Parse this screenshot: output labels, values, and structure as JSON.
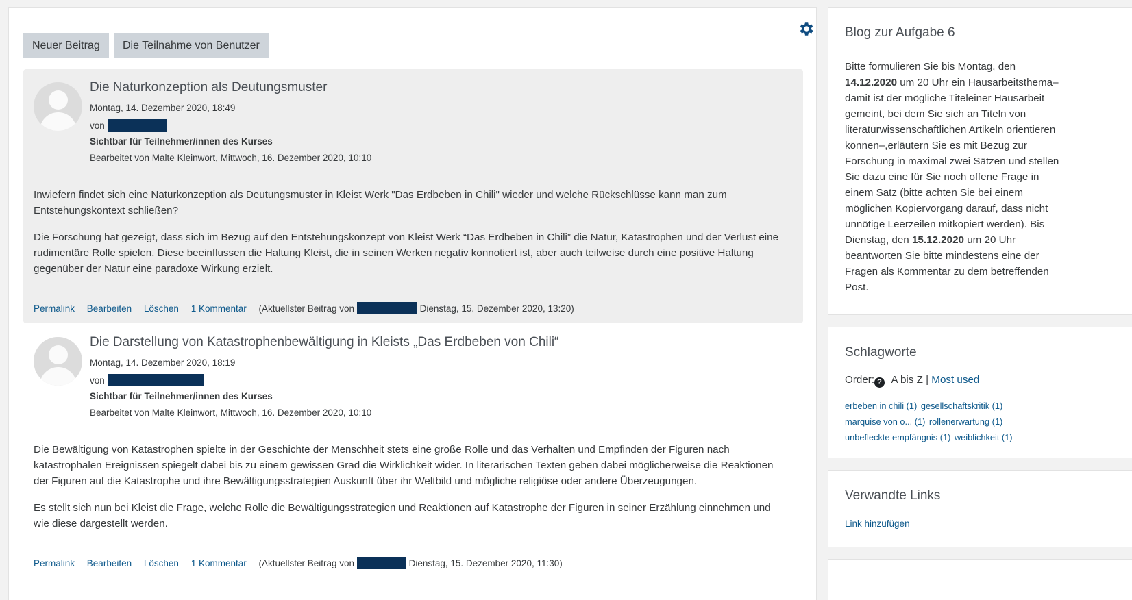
{
  "toolbar": {
    "new_entry_label": "Neuer Beitrag",
    "participation_label": "Die Teilnahme von Benutzer",
    "settings_icon": "gear-icon"
  },
  "posts": [
    {
      "title": "Die Naturkonzeption als Deutungsmuster",
      "date": "Montag, 14. Dezember 2020, 18:49",
      "by_label": "von",
      "visibility": "Sichtbar für Teilnehmer/innen des Kurses",
      "edited": "Bearbeitet von Malte Kleinwort, Mittwoch, 16. Dezember 2020, 10:10",
      "paragraphs": [
        "Inwiefern findet sich eine Naturkonzeption als Deutungsmuster in Kleist Werk \"Das Erdbeben in Chili\" wieder und welche Rückschlüsse kann man zum Entstehungskontext schließen?",
        "Die Forschung hat gezeigt, dass sich im Bezug auf den Entstehungskonzept von Kleist Werk “Das Erdbeben in Chili” die Natur, Katastrophen und der Verlust eine rudimentäre Rolle spielen. Diese beeinflussen die Haltung Kleist, die in seinen Werken negativ konnotiert ist, aber auch teilweise durch eine positive Haltung gegenüber der Natur eine paradoxe Wirkung erzielt."
      ],
      "footer": {
        "permalink": "Permalink",
        "edit": "Bearbeiten",
        "delete": "Löschen",
        "comments": "1 Kommentar",
        "latest_prefix": "(Aktuellster Beitrag von",
        "latest_suffix": "Dienstag, 15. Dezember 2020, 13:20)"
      }
    },
    {
      "title": "Die Darstellung von Katastrophenbewältigung in Kleists „Das Erdbeben von Chili“",
      "date": "Montag, 14. Dezember 2020, 18:19",
      "by_label": "von",
      "visibility": "Sichtbar für Teilnehmer/innen des Kurses",
      "edited": "Bearbeitet von Malte Kleinwort, Mittwoch, 16. Dezember 2020, 10:10",
      "paragraphs": [
        "Die Bewältigung von Katastrophen spielte in der Geschichte der Menschheit stets eine große Rolle und das Verhalten und Empfinden der Figuren nach katastrophalen Ereignissen spiegelt dabei bis zu einem gewissen Grad die Wirklichkeit wider. In literarischen Texten geben dabei möglicherweise die Reaktionen der Figuren auf die Katastrophe und ihre Bewältigungsstrategien Auskunft über ihr Weltbild und mögliche religiöse oder andere Überzeugungen.",
        "Es stellt sich nun bei Kleist die Frage, welche Rolle die Bewältigungsstrategien und Reaktionen auf Katastrophe der Figuren in seiner Erzählung einnehmen und wie diese dargestellt werden."
      ],
      "footer": {
        "permalink": "Permalink",
        "edit": "Bearbeiten",
        "delete": "Löschen",
        "comments": "1 Kommentar",
        "latest_prefix": "(Aktuellster Beitrag von",
        "latest_suffix": "Dienstag, 15. Dezember 2020, 11:30)"
      }
    }
  ],
  "sidebar": {
    "blog": {
      "title": "Blog zur Aufgabe 6",
      "desc_1": "Bitte formulieren Sie bis Montag, den",
      "desc_date1": "14.12.2020",
      "desc_2": " um 20 Uhr ein Hausarbeitsthema–damit ist der mögliche Titeleiner Hausarbeit gemeint, bei dem Sie sich an Titeln von literaturwissenschaftlichen Artikeln orientieren können–,erläutern Sie es mit Bezug zur Forschung in maximal zwei Sätzen und stellen Sie dazu eine für Sie noch offene Frage in einem Satz (bitte achten Sie bei einem möglichen Kopiervorgang darauf, dass nicht unnötige Leerzeilen mitkopiert werden). Bis Dienstag, den ",
      "desc_date2": "15.12.2020",
      "desc_3": " um 20 Uhr beantworten Sie bitte mindestens eine der Fragen als Kommentar zu dem betreffenden Post."
    },
    "tags": {
      "title": "Schlagworte",
      "order_label": "Order:",
      "order_az": "A bis Z",
      "order_sep": "|",
      "order_most": "Most used",
      "items": [
        "erbeben in chili (1)",
        "gesellschaftskritik (1)",
        "marquise von o... (1)",
        "rollenerwartung (1)",
        "unbefleckte empfängnis (1)",
        "weiblichkeit (1)"
      ]
    },
    "links": {
      "title": "Verwandte Links",
      "add_label": "Link hinzufügen"
    }
  },
  "colors": {
    "link": "#0f5a8c",
    "redaction": "#0b3158",
    "post_highlight": "#eeeeee",
    "button": "#ced4da"
  }
}
